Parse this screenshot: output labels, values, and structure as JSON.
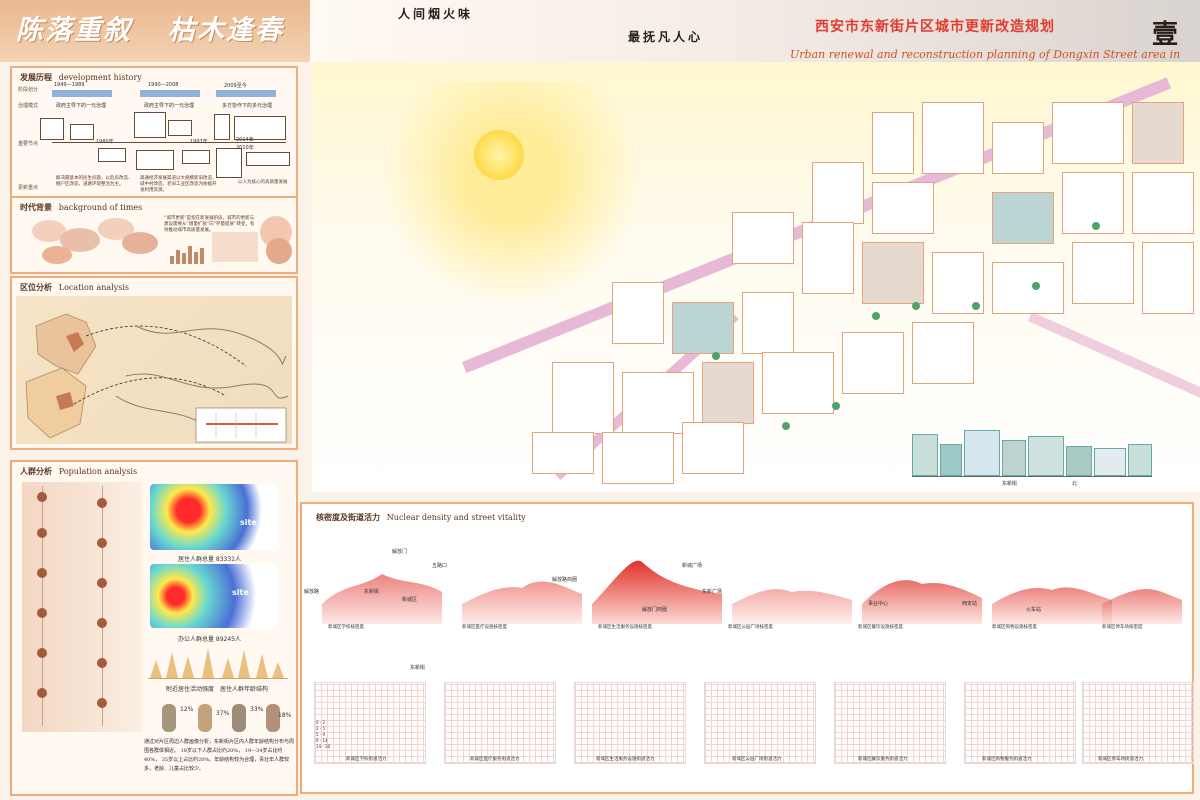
{
  "banner": {
    "left_title": "陈落重叙",
    "right_title": "枯木逢春"
  },
  "header": {
    "slogan_1": "人间烟火味",
    "slogan_2": "最抚凡人心",
    "title_cn": "西安市东新街片区城市更新改造规划",
    "title_en": "Urban renewal and reconstruction planning of Dongxin Street area in Xi'an City",
    "sheet_number": "壹"
  },
  "history": {
    "heading_cn": "发展历程",
    "heading_en": "development history",
    "row_labels": [
      "阶段划分",
      "治理模式",
      "重要节点",
      "更新重点"
    ],
    "periods": [
      "1949—1989",
      "1990—2008",
      "2009至今"
    ],
    "phases": [
      "政府主导下的一元治理",
      "政府主导下的一元治理",
      "多方协作下的多元治理"
    ],
    "years": [
      "1980年",
      "1997年",
      "2010年",
      "2014年"
    ],
    "focus": [
      "解决最基本的民生问题，以危房改造、棚户区改造、道路环境整治为主。",
      "疏通经济发展渠道以大规模新旧改造、城中村改造、老旧工业区改造为依据开发利用资源。",
      "以人为核心的高质量发展"
    ]
  },
  "times": {
    "heading_cn": "时代背景",
    "heading_en": "background of times",
    "note": "“城市更新”是指在新发展阶段，城市的更新与建设需要从“增量扩张”向“存量提质”转变，有效推动城市高质量发展。"
  },
  "location": {
    "heading_cn": "区位分析",
    "heading_en": "Location analysis"
  },
  "population": {
    "heading_cn": "人群分析",
    "heading_en": "Population analysis",
    "resident_total": "居住人群总量 83331人",
    "office_total": "办公人群总量 89245人",
    "caption_left": "附近居住活动强度",
    "caption_right": "居住人群年龄结构",
    "site_label": "site",
    "percents": [
      "12%",
      "37%",
      "33%",
      "18%"
    ],
    "paragraph": "通过对片区周边人群画像分析，东新街片区内人群年龄结构分布与周围各群体相近。 18岁以下人群占比约20%， 19—34岁占比约40%， 35岁以上占比约20%。年龄结构较为合理，青壮年人群较多，老龄、儿童占比较少。"
  },
  "axonometric": {
    "elevation_caption": "东新街",
    "scale_label": "北"
  },
  "density": {
    "heading_cn": "核密度及街道活力",
    "heading_en": "Nuclear density and street vitality",
    "callouts": [
      "解放门",
      "五路口",
      "东新街",
      "解放路",
      "新城区",
      "解放路商圈",
      "解放门商圈",
      "新城广场",
      "东新广场",
      "事业中心",
      "西安站",
      "火车站"
    ],
    "terrain_captions": [
      "新城区学校核密度",
      "新城区医疗设施核密度",
      "新城区生活服务设施核密度",
      "新城区公园广场核密度",
      "新城区餐饮设施核密度",
      "新城区购物设施核密度",
      "新城区停车场核密度"
    ],
    "map_captions": [
      "新城区学校街道活力",
      "新城区医疗服务街道活力",
      "新城区生活服务设施街道活力",
      "新城区公园广场街道活力",
      "新城区餐饮服务街道活力",
      "新城区购物服务街道活力",
      "新城区停车场街道活力"
    ],
    "legend_ranges": [
      "0 - 2",
      "2 - 5",
      "5 - 9",
      "9 - 14",
      "14 - 20"
    ],
    "map_label": "东新街"
  },
  "colors": {
    "accent": "#f0ac7b",
    "title_red": "#e23a2e",
    "road_pink": "#e8b9d6"
  }
}
